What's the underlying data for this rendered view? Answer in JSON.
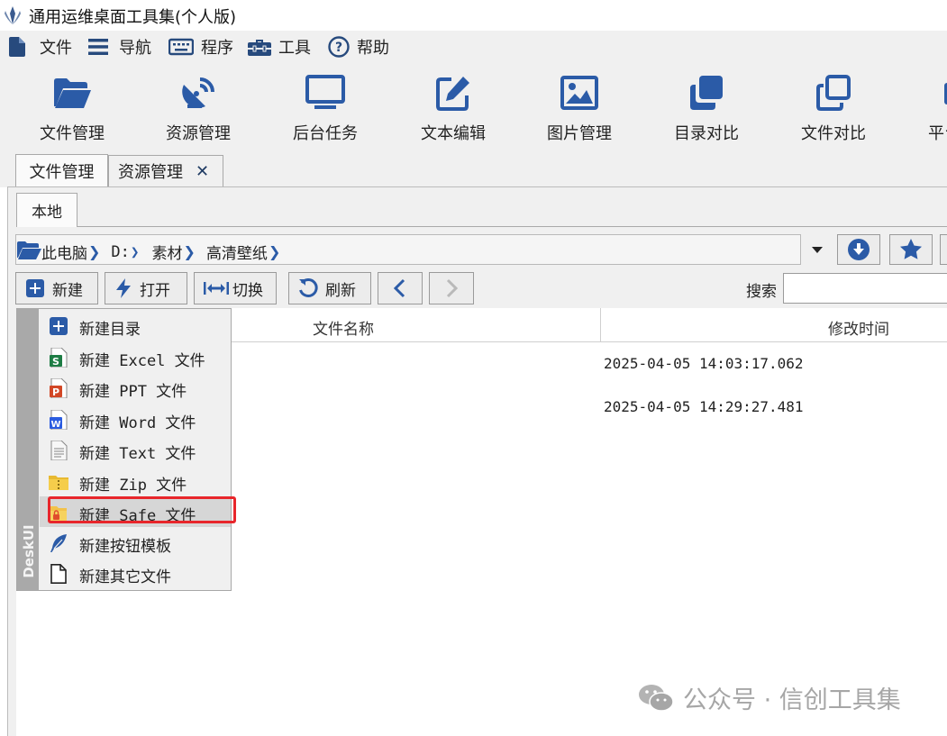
{
  "window": {
    "title": "通用运维桌面工具集(个人版)"
  },
  "menubar": {
    "file": "文件",
    "nav": "导航",
    "program": "程序",
    "tools": "工具",
    "help": "帮助"
  },
  "ribbon": {
    "items": [
      "文件管理",
      "资源管理",
      "后台任务",
      "文本编辑",
      "图片管理",
      "目录对比",
      "文件对比",
      "平台"
    ]
  },
  "tabs": {
    "tab1": "文件管理",
    "tab2": "资源管理",
    "close_glyph": "✕"
  },
  "subtab": {
    "local": "本地"
  },
  "path": {
    "crumbs": [
      "此电脑",
      "D:",
      "素材",
      "高清壁纸"
    ],
    "separator": "❯"
  },
  "toolbar": {
    "new_label": "新建",
    "open_label": "打开",
    "switch_label": "切换",
    "refresh_label": "刷新",
    "search_label": "搜索",
    "search_value": ""
  },
  "table": {
    "columns": [
      "文件名称",
      "修改时间"
    ],
    "rows": [
      {
        "modified": "2025-04-05 14:03:17.062"
      },
      {
        "modified": "2025-04-05 14:29:27.481"
      }
    ]
  },
  "new_menu": {
    "brand": "DeskUI",
    "items": [
      {
        "label": "新建目录",
        "icon": "add-folder-icon"
      },
      {
        "label": "新建 Excel 文件",
        "icon": "excel-file-icon"
      },
      {
        "label": "新建 PPT 文件",
        "icon": "ppt-file-icon"
      },
      {
        "label": "新建 Word 文件",
        "icon": "word-file-icon"
      },
      {
        "label": "新建 Text 文件",
        "icon": "text-file-icon"
      },
      {
        "label": "新建 Zip 文件",
        "icon": "zip-file-icon"
      },
      {
        "label": "新建 Safe 文件",
        "icon": "safe-file-icon"
      },
      {
        "label": "新建按钮模板",
        "icon": "feather-icon"
      },
      {
        "label": "新建其它文件",
        "icon": "blank-file-icon"
      }
    ],
    "selected_index": 6
  },
  "watermark": {
    "text": "公众号 · 信创工具集"
  },
  "colors": {
    "accent": "#2b5ba7",
    "highlight": "#e8262b"
  }
}
